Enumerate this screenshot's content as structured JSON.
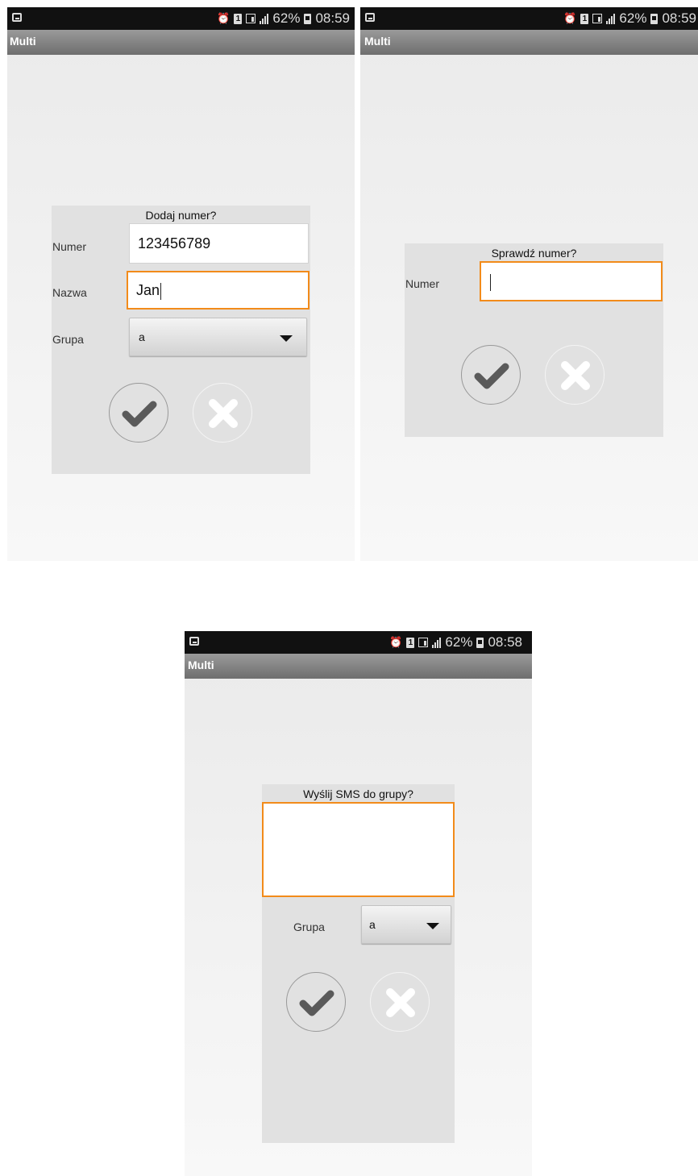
{
  "colors": {
    "accent": "#f28b1a",
    "statusbar": "#111111",
    "dialog": "#e1e1e1"
  },
  "screens": [
    {
      "status": {
        "battery": "62%",
        "time": "08:59"
      },
      "app_title": "Multi",
      "dialog": {
        "title": "Dodaj numer?",
        "numer_label": "Numer",
        "numer_value": "123456789",
        "nazwa_label": "Nazwa",
        "nazwa_value": "Jan",
        "grupa_label": "Grupa",
        "grupa_value": "a"
      }
    },
    {
      "status": {
        "battery": "62%",
        "time": "08:59"
      },
      "app_title": "Multi",
      "dialog": {
        "title": "Sprawdź numer?",
        "numer_label": "Numer",
        "numer_value": ""
      }
    },
    {
      "status": {
        "battery": "62%",
        "time": "08:58"
      },
      "app_title": "Multi",
      "dialog": {
        "title": "Wyślij SMS do grupy?",
        "message_value": "",
        "grupa_label": "Grupa",
        "grupa_value": "a"
      }
    }
  ]
}
